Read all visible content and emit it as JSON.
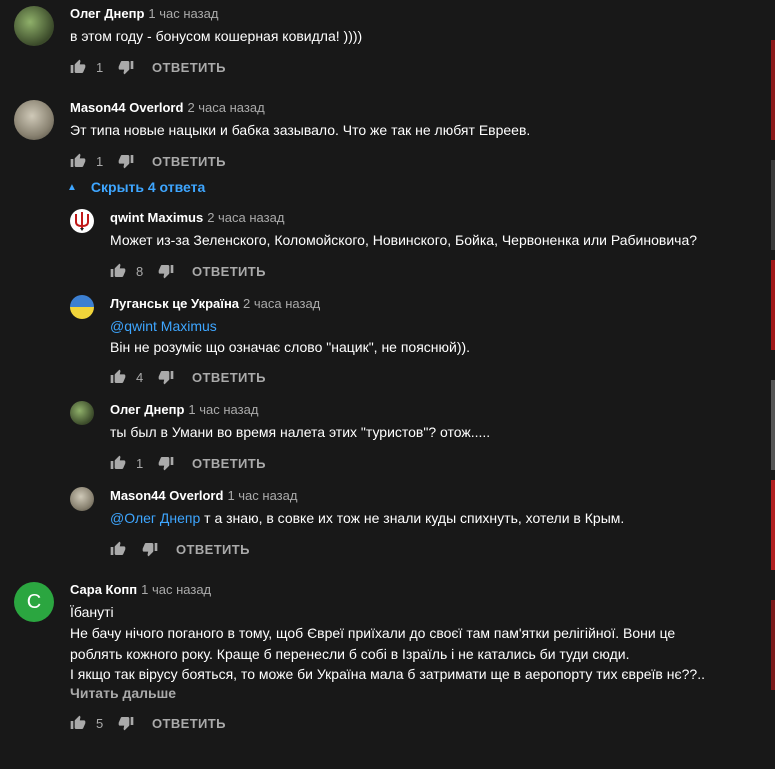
{
  "ui": {
    "reply_label": "ОТВЕТИТЬ",
    "hide_replies": "Скрыть 4 ответа",
    "read_more": "Читать дальше"
  },
  "comments": [
    {
      "author": "Олег Днепр",
      "time": "1 час назад",
      "text": "в этом году - бонусом кошерная ковидла! ))))",
      "likes": "1"
    },
    {
      "author": "Mason44 Overlord",
      "time": "2 часа назад",
      "text": "Эт типа новые нацыки и бабка зазывало. Что же так не любят Евреев.",
      "likes": "1"
    },
    {
      "author": "qwint Maximus",
      "time": "2 часа назад",
      "text": "Может из-за Зеленского, Коломойского, Новинского, Бойка, Червоненка или Рабиновича?",
      "likes": "8"
    },
    {
      "author": "Луганськ це Україна",
      "time": "2 часа назад",
      "mention": "@qwint Maximus",
      "text": "Він не розуміє що означає слово \"нацик\", не пояснюй)).",
      "likes": "4"
    },
    {
      "author": "Олег Днепр",
      "time": "1 час назад",
      "text": "ты был в Умани во время налета этих \"туристов\"? отож.....",
      "likes": "1"
    },
    {
      "author": "Mason44 Overlord",
      "time": "1 час назад",
      "mention": "@Олег Днепр",
      "text": " т а знаю, в совке их тож не знали куды спихнуть, хотели в Крым.",
      "likes": ""
    },
    {
      "author": "Сара Копп",
      "time": "1 час назад",
      "avatar_letter": "C",
      "lines": [
        "Їбанутi",
        "Не бачу нічого поганого в тому, щоб Євреї приїхали до своєї там пам'ятки релігійної. Вони це",
        "роблять кожного року. Краще б перенесли б собі в Ізраїль і не катались би туди сюди.",
        "І якщо так вірусу бояться, то може би Україна мала б затримати ще в аеропорту тих євреїв нє??.."
      ],
      "likes": "5"
    }
  ],
  "colors": {
    "background": "#181818",
    "link": "#3ea6ff",
    "muted": "#aaa",
    "avatar_green": "#2ba640"
  }
}
